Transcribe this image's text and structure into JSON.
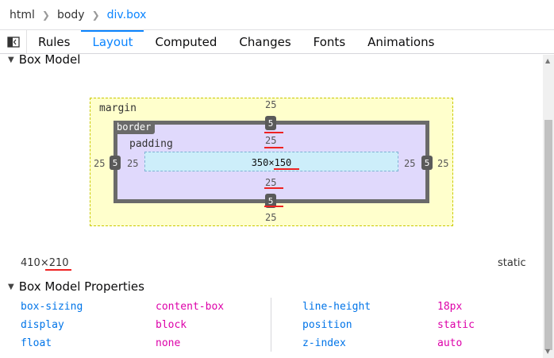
{
  "breadcrumb": {
    "items": [
      "html",
      "body",
      "div.box"
    ]
  },
  "tabs": [
    "Rules",
    "Layout",
    "Computed",
    "Changes",
    "Fonts",
    "Animations"
  ],
  "sections": {
    "box_model": "Box Model",
    "box_model_properties": "Box Model Properties"
  },
  "box_model": {
    "margin_label": "margin",
    "border_label": "border",
    "padding_label": "padding",
    "margin": {
      "top": "25",
      "right": "25",
      "bottom": "25",
      "left": "25"
    },
    "border": {
      "top": "5",
      "right": "5",
      "bottom": "5",
      "left": "5"
    },
    "padding": {
      "top": "25",
      "right": "25",
      "bottom": "25",
      "left": "25"
    },
    "content": "350×150"
  },
  "element_size": "410×210",
  "position_value": "static",
  "properties": [
    {
      "name": "box-sizing",
      "value": "content-box"
    },
    {
      "name": "display",
      "value": "block"
    },
    {
      "name": "float",
      "value": "none"
    },
    {
      "name": "line-height",
      "value": "18px"
    },
    {
      "name": "position",
      "value": "static"
    },
    {
      "name": "z-index",
      "value": "auto"
    }
  ],
  "colors": {
    "accent": "#0a84ff",
    "annotation": "#ee2222"
  }
}
